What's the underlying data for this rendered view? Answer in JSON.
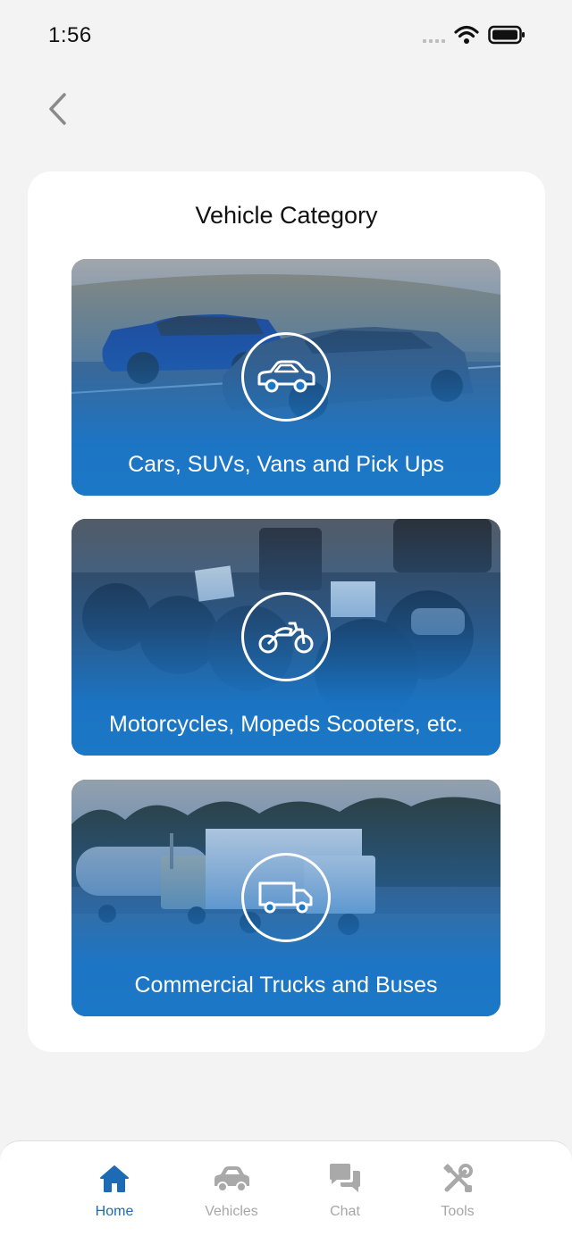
{
  "status_bar": {
    "time": "1:56"
  },
  "page": {
    "title": "Vehicle Category"
  },
  "categories": [
    {
      "label": "Cars, SUVs, Vans and Pick Ups",
      "icon": "car-icon"
    },
    {
      "label": "Motorcycles, Mopeds Scooters, etc.",
      "icon": "motorcycle-icon"
    },
    {
      "label": "Commercial Trucks and Buses",
      "icon": "truck-icon"
    }
  ],
  "bottom_nav": [
    {
      "label": "Home",
      "icon": "home-icon",
      "active": true
    },
    {
      "label": "Vehicles",
      "icon": "car-icon",
      "active": false
    },
    {
      "label": "Chat",
      "icon": "chat-icon",
      "active": false
    },
    {
      "label": "Tools",
      "icon": "tools-icon",
      "active": false
    }
  ],
  "colors": {
    "accent": "#1c6bb4",
    "tile_blue": "#1b78c6",
    "inactive": "#a7a7a7",
    "background": "#f3f3f3"
  }
}
